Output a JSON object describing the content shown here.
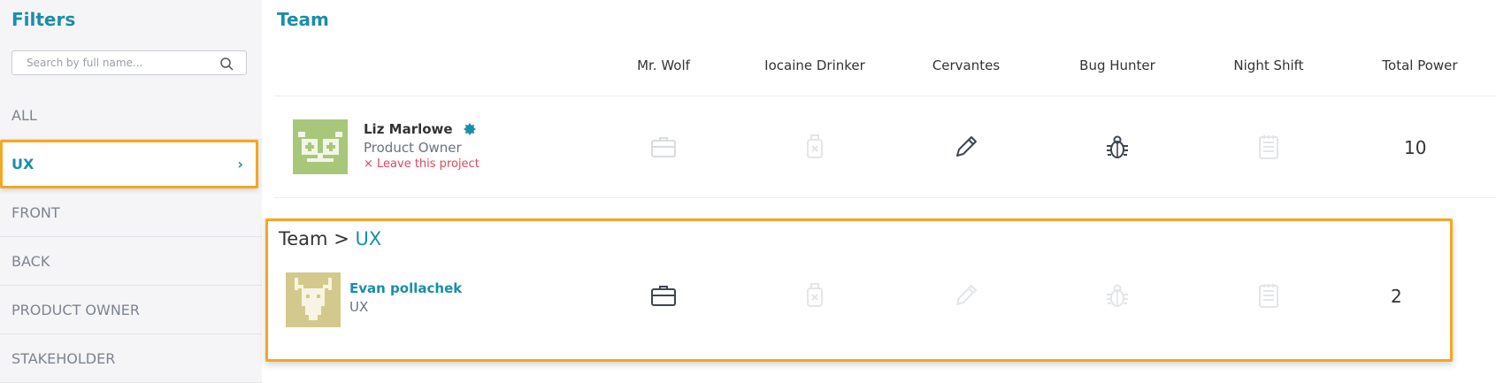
{
  "sidebar": {
    "title": "Filters",
    "search_placeholder": "Search by full name...",
    "items": [
      {
        "label": "ALL"
      },
      {
        "label": "UX"
      },
      {
        "label": "FRONT"
      },
      {
        "label": "BACK"
      },
      {
        "label": "PRODUCT OWNER"
      },
      {
        "label": "STAKEHOLDER"
      }
    ],
    "active_chevron": "›"
  },
  "main": {
    "title": "Team",
    "columns": [
      "Mr. Wolf",
      "Iocaine Drinker",
      "Cervantes",
      "Bug Hunter",
      "Night Shift",
      "Total Power"
    ],
    "members": [
      {
        "name": "Liz Marlowe",
        "role": "Product Owner",
        "leave_label": "× Leave this project",
        "total": "10",
        "active_badges": [
          "Cervantes",
          "Bug Hunter"
        ]
      },
      {
        "name": "Evan pollachek",
        "role": "UX",
        "total": "2",
        "active_badges": [
          "Mr. Wolf"
        ]
      }
    ]
  },
  "breadcrumb": {
    "root": "Team",
    "separator": ">",
    "current": "UX"
  },
  "colors": {
    "accent": "#1a8ea8",
    "highlight": "#f5a623",
    "danger": "#e0475b",
    "owl_avatar": "#a9c77a",
    "deer_avatar": "#d4c98c"
  }
}
